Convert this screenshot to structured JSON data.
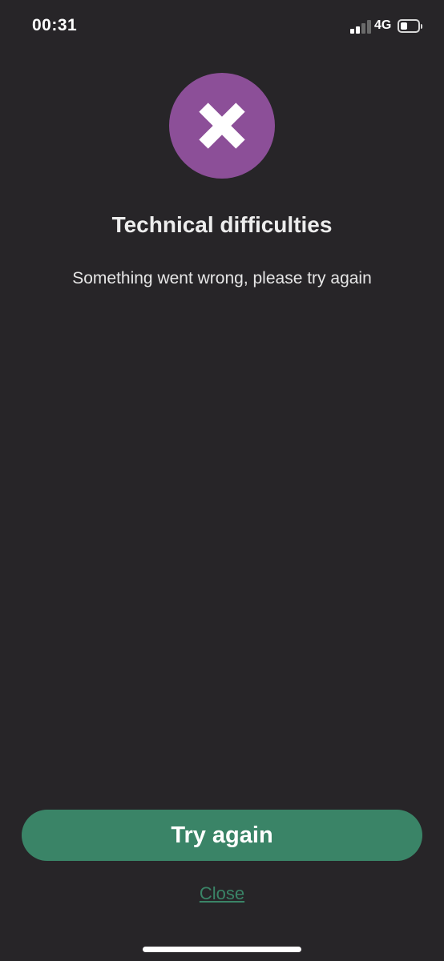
{
  "status_bar": {
    "time": "00:31",
    "network": "4G",
    "signal_bars": 2,
    "signal_bars_total": 4,
    "battery_level": 0.4,
    "signal_color": "#ffffff",
    "signal_inactive_color": "#6a6a6a"
  },
  "error": {
    "icon": "close-x-icon",
    "icon_color": "#8c4f98",
    "title": "Technical difficulties",
    "message": "Something went wrong, please try again"
  },
  "actions": {
    "primary_label": "Try again",
    "primary_color": "#3a8467",
    "secondary_label": "Close"
  }
}
